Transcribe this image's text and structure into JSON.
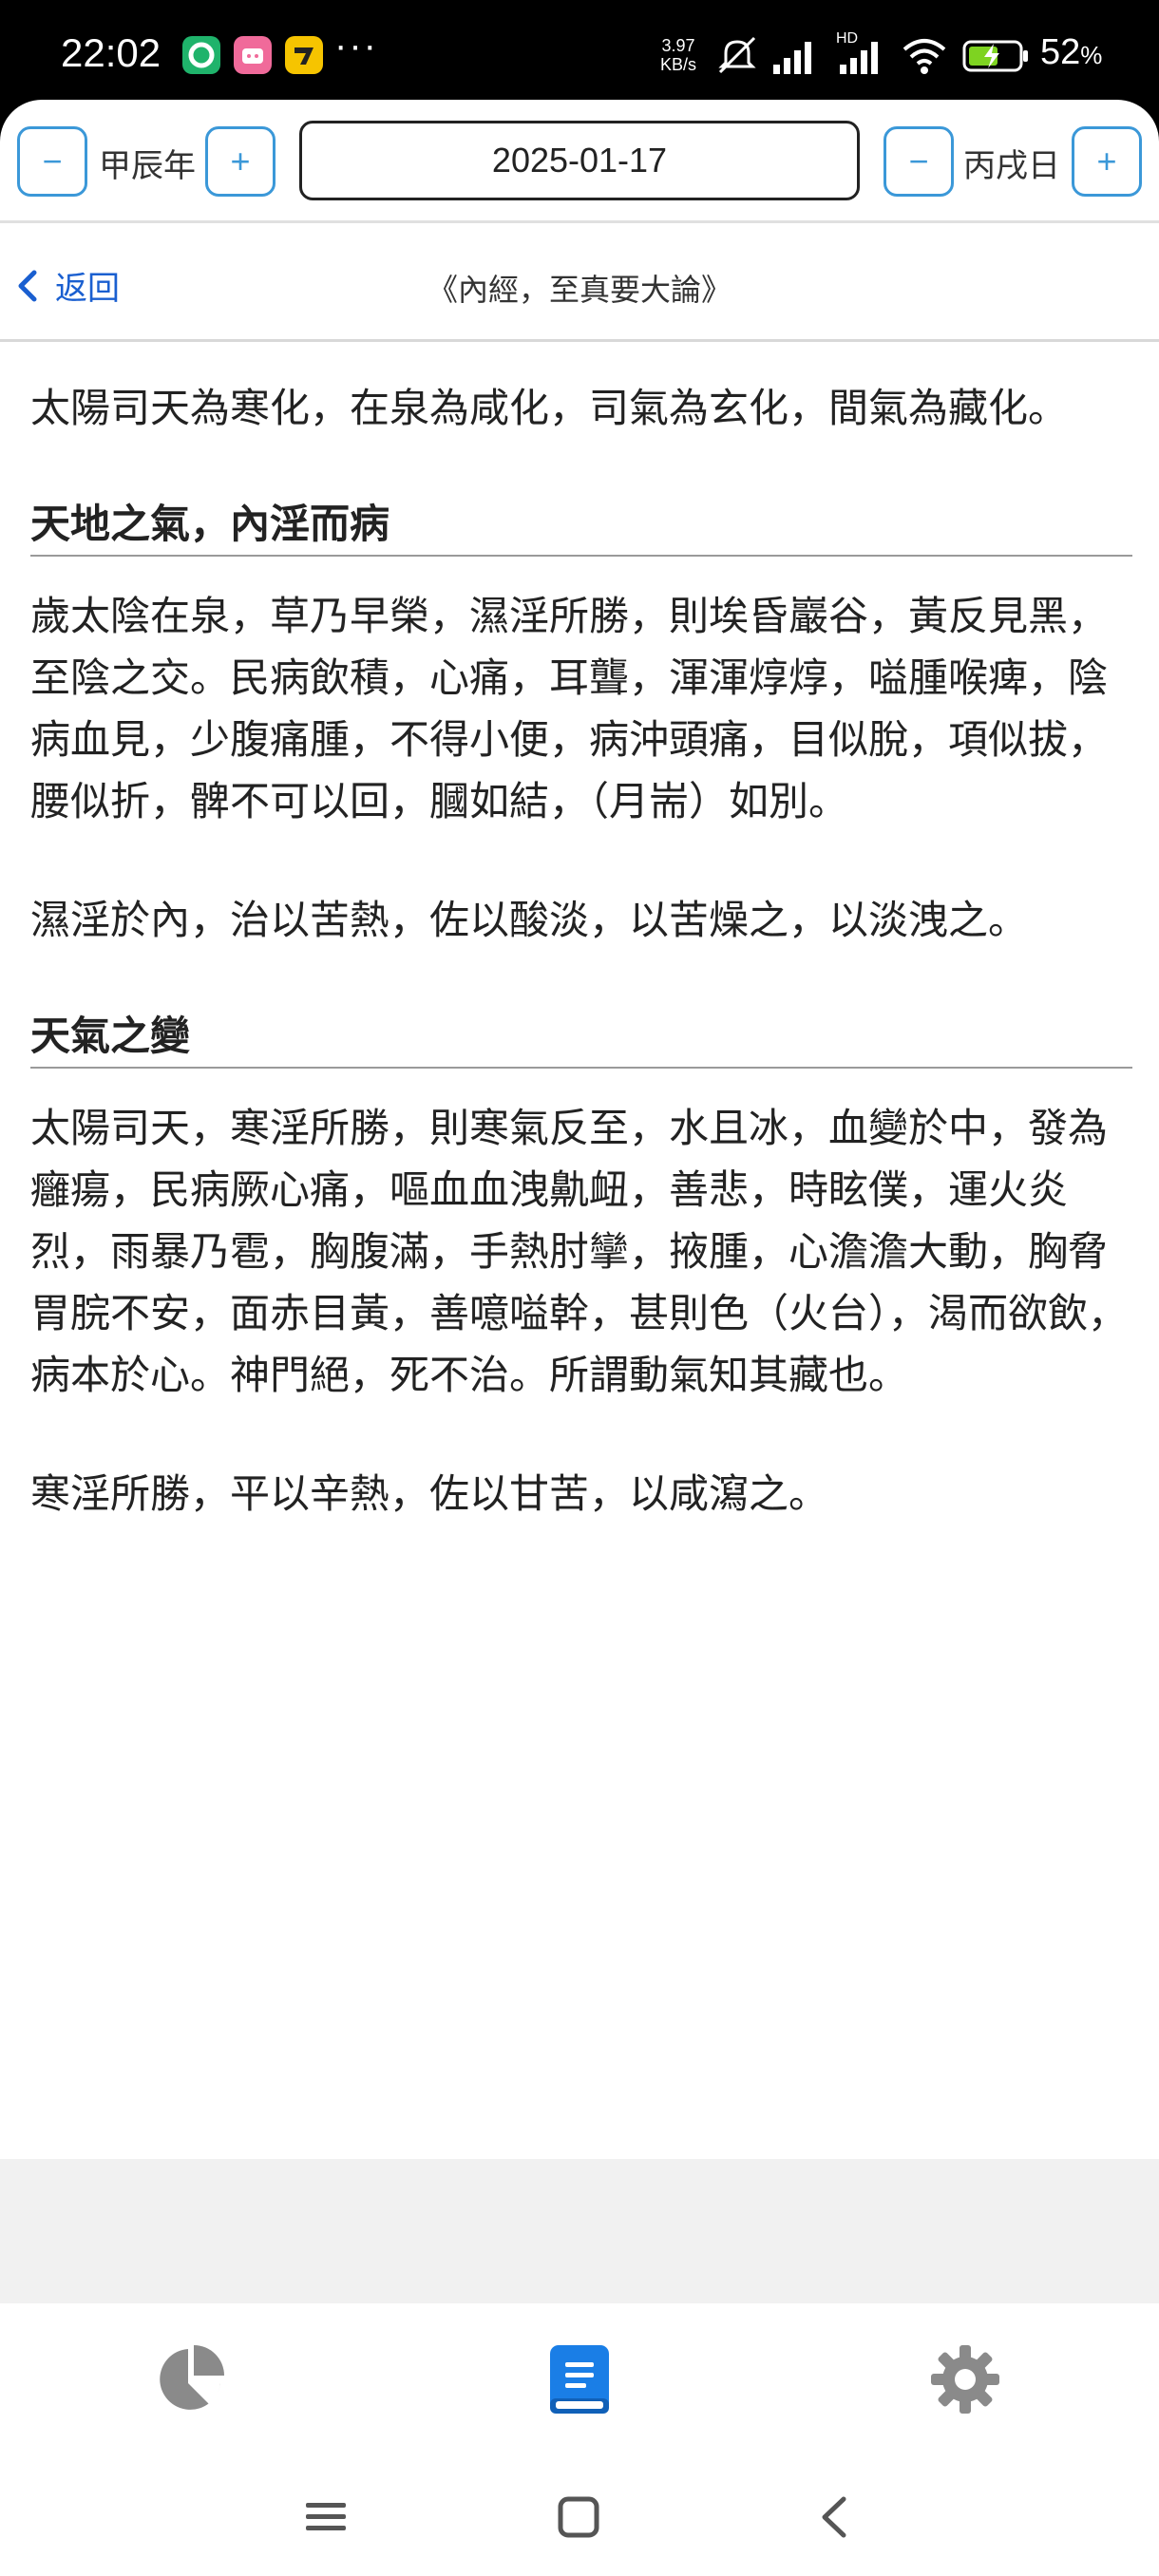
{
  "status_bar": {
    "time": "22:02",
    "more": "···",
    "net_speed_value": "3.97",
    "net_speed_unit": "KB/s",
    "network_badge": "HD",
    "battery_percent": "52"
  },
  "date_bar": {
    "year_label": "甲辰年",
    "day_label": "丙戌日",
    "date_value": "2025-01-17",
    "decrement_symbol": "−",
    "increment_symbol": "+"
  },
  "nav": {
    "back_label": "返回",
    "title": "《內經，至真要大論》"
  },
  "content": {
    "intro": "太陽司天為寒化，在泉為咸化，司氣為玄化，間氣為藏化。",
    "section1": {
      "heading": "天地之氣，內淫而病",
      "paragraphs": [
        "歲太陰在泉，草乃早榮，濕淫所勝，則埃昏巖谷，黃反見黑，至陰之交。民病飲積，心痛，耳聾，渾渾焞焞，嗌腫喉痺，陰病血見，少腹痛腫，不得小便，病沖頭痛，目似脫，項似拔，腰似折，髀不可以回，膕如結，（月耑）如別。",
        "濕淫於內，治以苦熱，佐以酸淡，以苦燥之，以淡洩之。"
      ]
    },
    "section2": {
      "heading": "天氣之變",
      "paragraphs": [
        "太陽司天，寒淫所勝，則寒氣反至，水且冰，血變於中，發為癰瘍，民病厥心痛，嘔血血洩鼽衄，善悲，時眩僕，運火炎烈，雨暴乃雹，胸腹滿，手熱肘攣，掖腫，心澹澹大動，胸脅胃脘不安，面赤目黃，善噫嗌幹，甚則色（火台），渴而欲飲，病本於心。神門絕，死不治。所謂動氣知其藏也。",
        "寒淫所勝，平以辛熱，佐以甘苦，以咸瀉之。"
      ]
    }
  },
  "tabs": [
    {
      "icon": "pie-chart-icon",
      "active": false
    },
    {
      "icon": "book-icon",
      "active": true
    },
    {
      "icon": "gear-icon",
      "active": false
    }
  ],
  "colors": {
    "accent": "#3b98d8",
    "link": "#1a5fd0",
    "active_tab": "#1a7ee6",
    "inactive_tab": "#8a8a8a"
  }
}
